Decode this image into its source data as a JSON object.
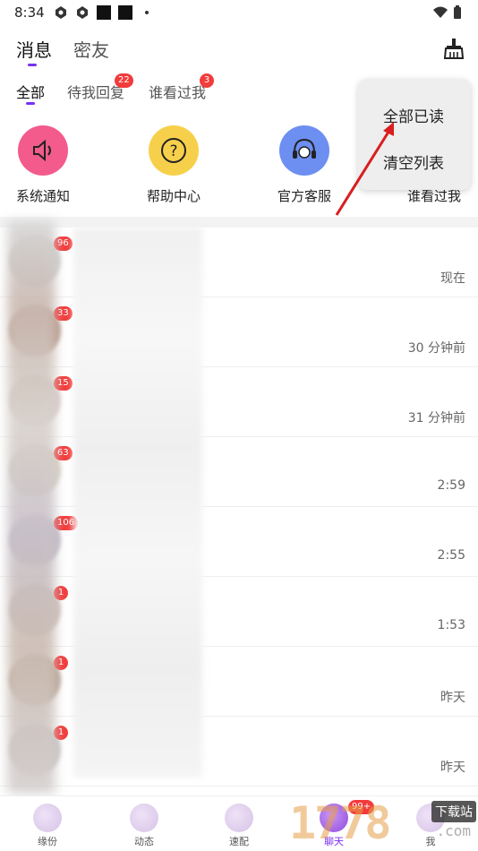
{
  "status_bar": {
    "time": "8:34"
  },
  "top_tabs": [
    {
      "label": "消息",
      "active": true
    },
    {
      "label": "密友",
      "active": false
    }
  ],
  "sub_tabs": [
    {
      "label": "全部",
      "active": true,
      "badge": ""
    },
    {
      "label": "待我回复",
      "active": false,
      "badge": "22"
    },
    {
      "label": "谁看过我",
      "active": false,
      "badge": "3"
    }
  ],
  "quick_actions": [
    {
      "label": "系统通知",
      "icon": "speaker-icon",
      "color": "#f25b8c"
    },
    {
      "label": "帮助中心",
      "icon": "question-icon",
      "color": "#f7d04b"
    },
    {
      "label": "官方客服",
      "icon": "headset-icon",
      "color": "#6d8ff2"
    },
    {
      "label": "谁看过我",
      "icon": "eye-icon",
      "color": "#b07af2"
    }
  ],
  "popup_menu": {
    "items": [
      "全部已读",
      "清空列表"
    ]
  },
  "messages": [
    {
      "badge": "96",
      "time": "现在"
    },
    {
      "badge": "33",
      "time": "30 分钟前"
    },
    {
      "badge": "15",
      "time": "31 分钟前"
    },
    {
      "badge": "63",
      "time": "2:59"
    },
    {
      "badge": "106",
      "time": "2:55"
    },
    {
      "badge": "1",
      "time": "1:53"
    },
    {
      "badge": "1",
      "time": "昨天"
    },
    {
      "badge": "1",
      "time": "昨天"
    }
  ],
  "bottom_nav": [
    {
      "label": "缘份"
    },
    {
      "label": "动态"
    },
    {
      "label": "速配"
    },
    {
      "label": "聊天",
      "badge": "99+"
    },
    {
      "label": "我"
    }
  ],
  "watermark": {
    "text": "1778",
    "tag": "下载站",
    "domain": ".com"
  },
  "colors": {
    "accent": "#7b2ff7",
    "badge": "#f23b3b",
    "arrow": "#d81e1e"
  }
}
